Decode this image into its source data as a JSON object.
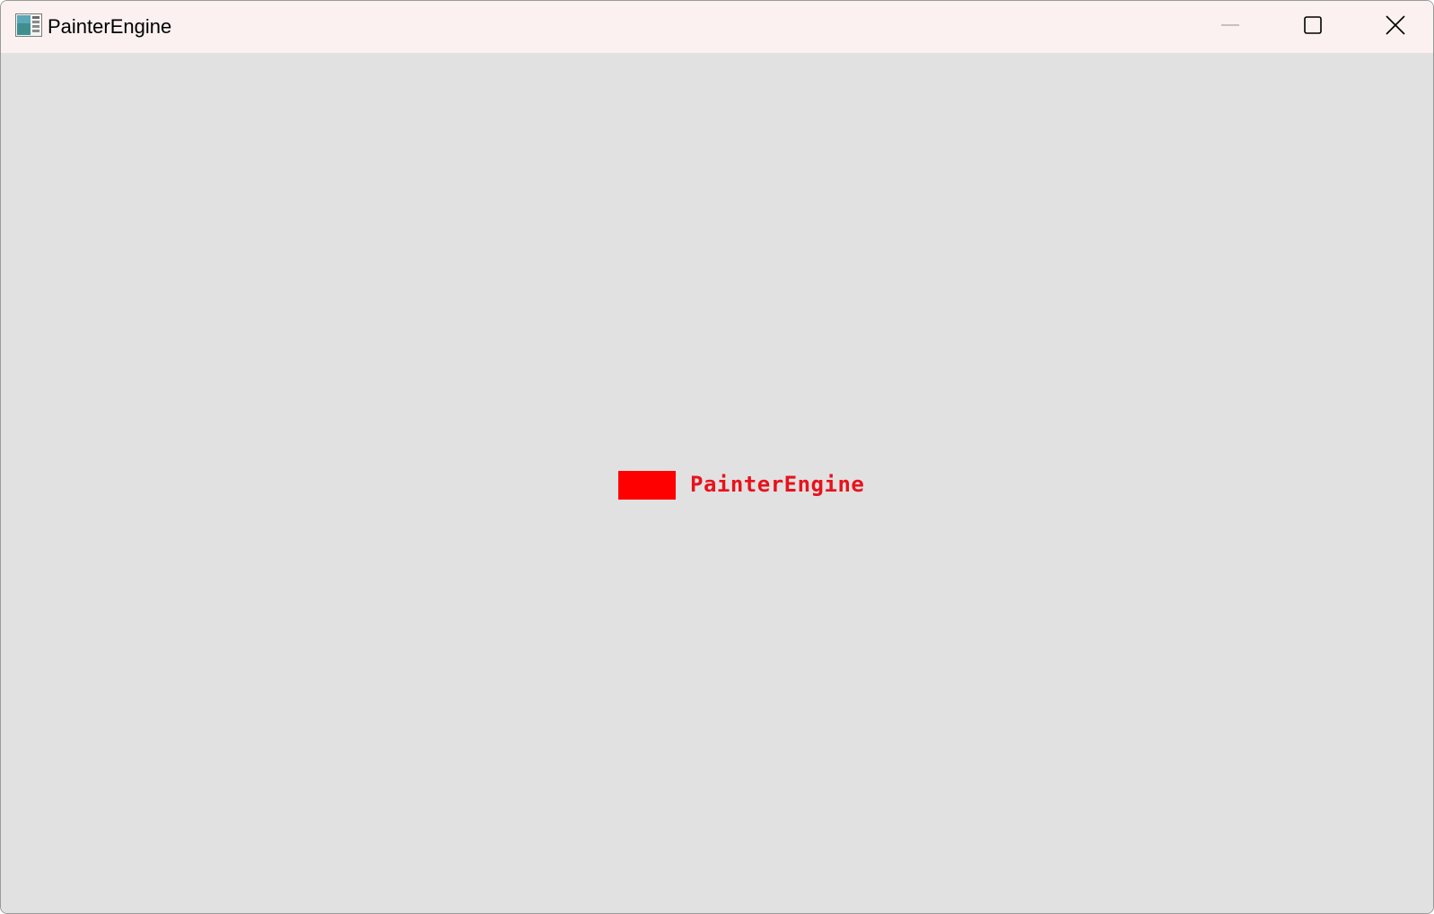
{
  "window": {
    "title": "PainterEngine",
    "icon": "app-window-icon"
  },
  "titlebar_buttons": {
    "minimize_icon": "minimize-icon",
    "maximize_icon": "maximize-icon",
    "close_icon": "close-icon"
  },
  "canvas": {
    "background_color": "#e1e1e1",
    "swatch_color": "#ff0000",
    "label": "PainterEngine",
    "label_color": "#e8121b"
  }
}
